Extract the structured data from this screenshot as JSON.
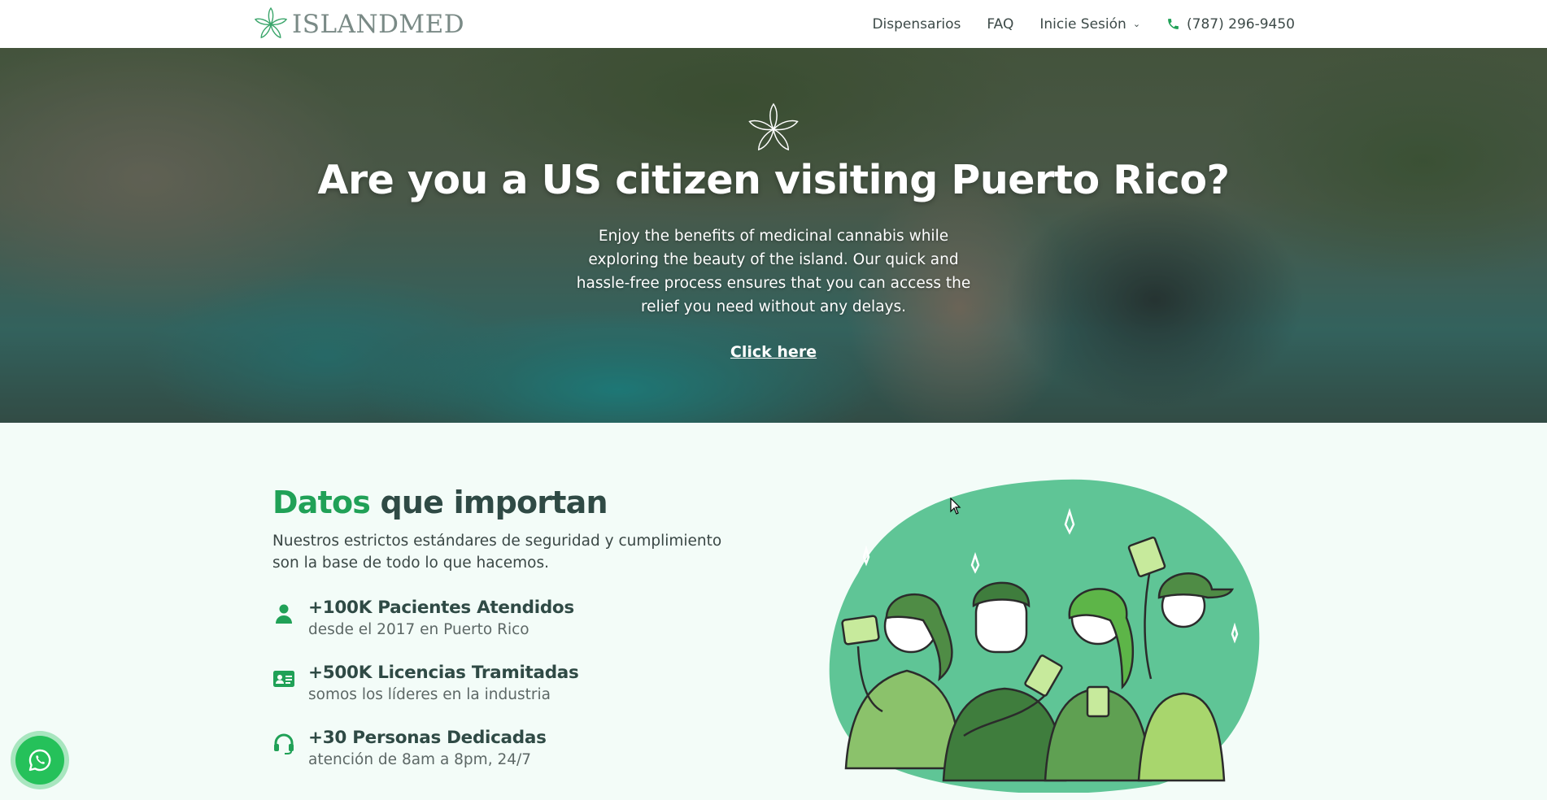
{
  "header": {
    "logo_text": "ISLANDMED",
    "nav": [
      {
        "label": "Dispensarios"
      },
      {
        "label": "FAQ"
      },
      {
        "label": "Inicie Sesión"
      }
    ],
    "phone": "(787) 296-9450"
  },
  "hero": {
    "title": "Are you a US citizen visiting Puerto Rico?",
    "text": "Enjoy the benefits of medicinal cannabis while exploring the beauty of the island. Our quick and hassle-free process ensures that you can access the relief you need without any delays.",
    "link": "Click here"
  },
  "stats_section": {
    "title_accent": "Datos",
    "title_rest": " que importan",
    "lead": "Nuestros estrictos estándares de seguridad y cumplimiento son la base de todo lo que hacemos.",
    "items": [
      {
        "icon": "person-icon",
        "title": "+100K Pacientes Atendidos",
        "sub": "desde el 2017 en Puerto Rico"
      },
      {
        "icon": "id-card-icon",
        "title": "+500K Licencias Tramitadas",
        "sub": "somos los líderes en la industria"
      },
      {
        "icon": "headset-icon",
        "title": "+30 Personas Dedicadas",
        "sub": "atención de 8am a 8pm, 24/7"
      }
    ]
  },
  "colors": {
    "brand_green": "#20a157",
    "dark_teal": "#2f4a45",
    "section_bg": "#f3fcf8",
    "whatsapp": "#25c15a"
  }
}
